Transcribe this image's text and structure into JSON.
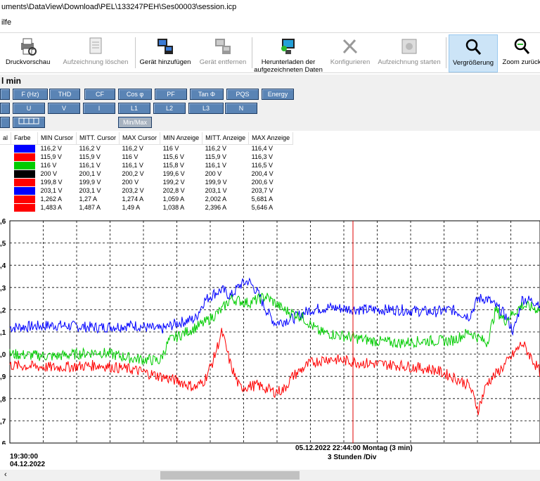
{
  "window": {
    "path": "uments\\DataView\\Download\\PEL\\133247PEH\\Ses00003\\session.icp"
  },
  "menu": {
    "item": "ilfe"
  },
  "toolbar": {
    "buttons": [
      {
        "label": "Druckvorschau",
        "icon": "print-preview-icon"
      },
      {
        "label": "Aufzeichnung löschen",
        "icon": "delete-record-icon"
      },
      {
        "label": "Gerät hinzufügen",
        "icon": "add-device-icon"
      },
      {
        "label": "Gerät entfernen",
        "icon": "remove-device-icon"
      },
      {
        "label": "Herunterladen der aufgezeichneten Daten",
        "icon": "download-icon"
      },
      {
        "label": "Konfigurieren",
        "icon": "configure-icon"
      },
      {
        "label": "Aufzeichnung starten",
        "icon": "start-record-icon"
      },
      {
        "label": "Vergrößerung",
        "icon": "zoom-icon"
      },
      {
        "label": "Zoom zurück",
        "icon": "zoom-back-icon"
      }
    ]
  },
  "panel": {
    "title": "l min"
  },
  "ctrl": {
    "row1": [
      "F (Hz)",
      "THD",
      "CF",
      "Cos φ",
      "PF",
      "Tan Φ",
      "PQS",
      "Energy"
    ],
    "row2": [
      "U",
      "V",
      "I",
      "L1",
      "L2",
      "L3",
      "N"
    ],
    "row3": [
      "Min/Max"
    ]
  },
  "table": {
    "headers": [
      "al",
      "Farbe",
      "MIN Cursor",
      "MITT. Cursor",
      "MAX Cursor",
      "MIN Anzeige",
      "MITT. Anzeige",
      "MAX Anzeige"
    ],
    "rows": [
      {
        "color": "#0000ff",
        "cells": [
          "116,2 V",
          "116,2 V",
          "116,2 V",
          "116 V",
          "116,2 V",
          "116,4 V"
        ]
      },
      {
        "color": "#ff0000",
        "cells": [
          "115,9 V",
          "115,9 V",
          "116 V",
          "115,6 V",
          "115,9 V",
          "116,3 V"
        ]
      },
      {
        "color": "#00cc00",
        "cells": [
          "116 V",
          "116,1 V",
          "116,1 V",
          "115,8 V",
          "116,1 V",
          "116,5 V"
        ]
      },
      {
        "color": "#000000",
        "cells": [
          "200 V",
          "200,1 V",
          "200,2 V",
          "199,6 V",
          "200 V",
          "200,4 V"
        ]
      },
      {
        "color": "#ff0000",
        "cells": [
          "199,8 V",
          "199,9 V",
          "200 V",
          "199,2 V",
          "199,9 V",
          "200,6 V"
        ]
      },
      {
        "color": "#0000ff",
        "cells": [
          "203,1 V",
          "203,1 V",
          "203,2 V",
          "202,8 V",
          "203,1 V",
          "203,7 V"
        ]
      },
      {
        "color": "#ff0000",
        "cells": [
          "1,262 A",
          "1,27 A",
          "1,274 A",
          "1,059 A",
          "2,002 A",
          "5,681 A"
        ]
      },
      {
        "color": "#ff0000",
        "cells": [
          "1,483 A",
          "1,487 A",
          "1,49 A",
          "1,038 A",
          "2,396 A",
          "5,646 A"
        ]
      }
    ]
  },
  "chart_data": {
    "type": "line",
    "y_tick_labels": [
      ",6",
      ",5",
      ",4",
      ",3",
      ",2",
      ",1",
      ",0",
      ",9",
      ",8",
      ",7",
      ",6"
    ],
    "ylim": [
      115.6,
      116.6
    ],
    "x_start": {
      "time": "19:30:00",
      "date": "04.12.2022"
    },
    "cursor": {
      "label": "05.12.2022 22:44:00 Montag (3 min)"
    },
    "scale_label": "3 Stunden /Div",
    "series": [
      {
        "color": "#0000ff",
        "points": [
          [
            0,
            116.12
          ],
          [
            5,
            116.13
          ],
          [
            10,
            116.12
          ],
          [
            14,
            116.13
          ],
          [
            17,
            116.11
          ],
          [
            19,
            116.14
          ],
          [
            21,
            116.16
          ],
          [
            22,
            116.24
          ],
          [
            23,
            116.27
          ],
          [
            24,
            116.29
          ],
          [
            25,
            116.26
          ],
          [
            26,
            116.31
          ],
          [
            27,
            116.33
          ],
          [
            28,
            116.28
          ],
          [
            29,
            116.2
          ],
          [
            30,
            116.14
          ],
          [
            32,
            116.16
          ],
          [
            34,
            116.2
          ],
          [
            36,
            116.21
          ],
          [
            40,
            116.2
          ],
          [
            44,
            116.2
          ],
          [
            48,
            116.19
          ],
          [
            50,
            116.2
          ],
          [
            52,
            116.17
          ],
          [
            53,
            116.25
          ],
          [
            54,
            116.25
          ],
          [
            56,
            116.18
          ],
          [
            57,
            116.1
          ],
          [
            58,
            116.25
          ],
          [
            60,
            116.23
          ]
        ]
      },
      {
        "color": "#00cc00",
        "points": [
          [
            0,
            116.0
          ],
          [
            5,
            115.99
          ],
          [
            10,
            116.01
          ],
          [
            14,
            115.98
          ],
          [
            17,
            115.97
          ],
          [
            18,
            116.06
          ],
          [
            20,
            116.1
          ],
          [
            22,
            116.14
          ],
          [
            24,
            116.2
          ],
          [
            25,
            116.25
          ],
          [
            27,
            116.23
          ],
          [
            29,
            116.26
          ],
          [
            31,
            116.2
          ],
          [
            33,
            116.17
          ],
          [
            35,
            116.1
          ],
          [
            38,
            116.08
          ],
          [
            41,
            116.06
          ],
          [
            44,
            116.05
          ],
          [
            47,
            116.06
          ],
          [
            50,
            116.06
          ],
          [
            52,
            116.1
          ],
          [
            54,
            116.05
          ],
          [
            55,
            116.2
          ],
          [
            56,
            116.15
          ],
          [
            58,
            116.22
          ],
          [
            60,
            116.2
          ]
        ]
      },
      {
        "color": "#ff0000",
        "points": [
          [
            0,
            115.95
          ],
          [
            5,
            115.94
          ],
          [
            10,
            115.95
          ],
          [
            14,
            115.93
          ],
          [
            17,
            115.9
          ],
          [
            19,
            115.88
          ],
          [
            21,
            115.85
          ],
          [
            22,
            115.88
          ],
          [
            23,
            115.97
          ],
          [
            24,
            116.1
          ],
          [
            25,
            115.95
          ],
          [
            26,
            115.85
          ],
          [
            28,
            115.86
          ],
          [
            30,
            115.83
          ],
          [
            31,
            115.84
          ],
          [
            32,
            115.9
          ],
          [
            34,
            115.96
          ],
          [
            36,
            115.98
          ],
          [
            40,
            115.96
          ],
          [
            44,
            115.95
          ],
          [
            48,
            115.93
          ],
          [
            50,
            115.9
          ],
          [
            52,
            115.86
          ],
          [
            53,
            115.75
          ],
          [
            54,
            115.87
          ],
          [
            56,
            115.95
          ],
          [
            58,
            116.05
          ],
          [
            60,
            115.92
          ]
        ]
      }
    ]
  }
}
